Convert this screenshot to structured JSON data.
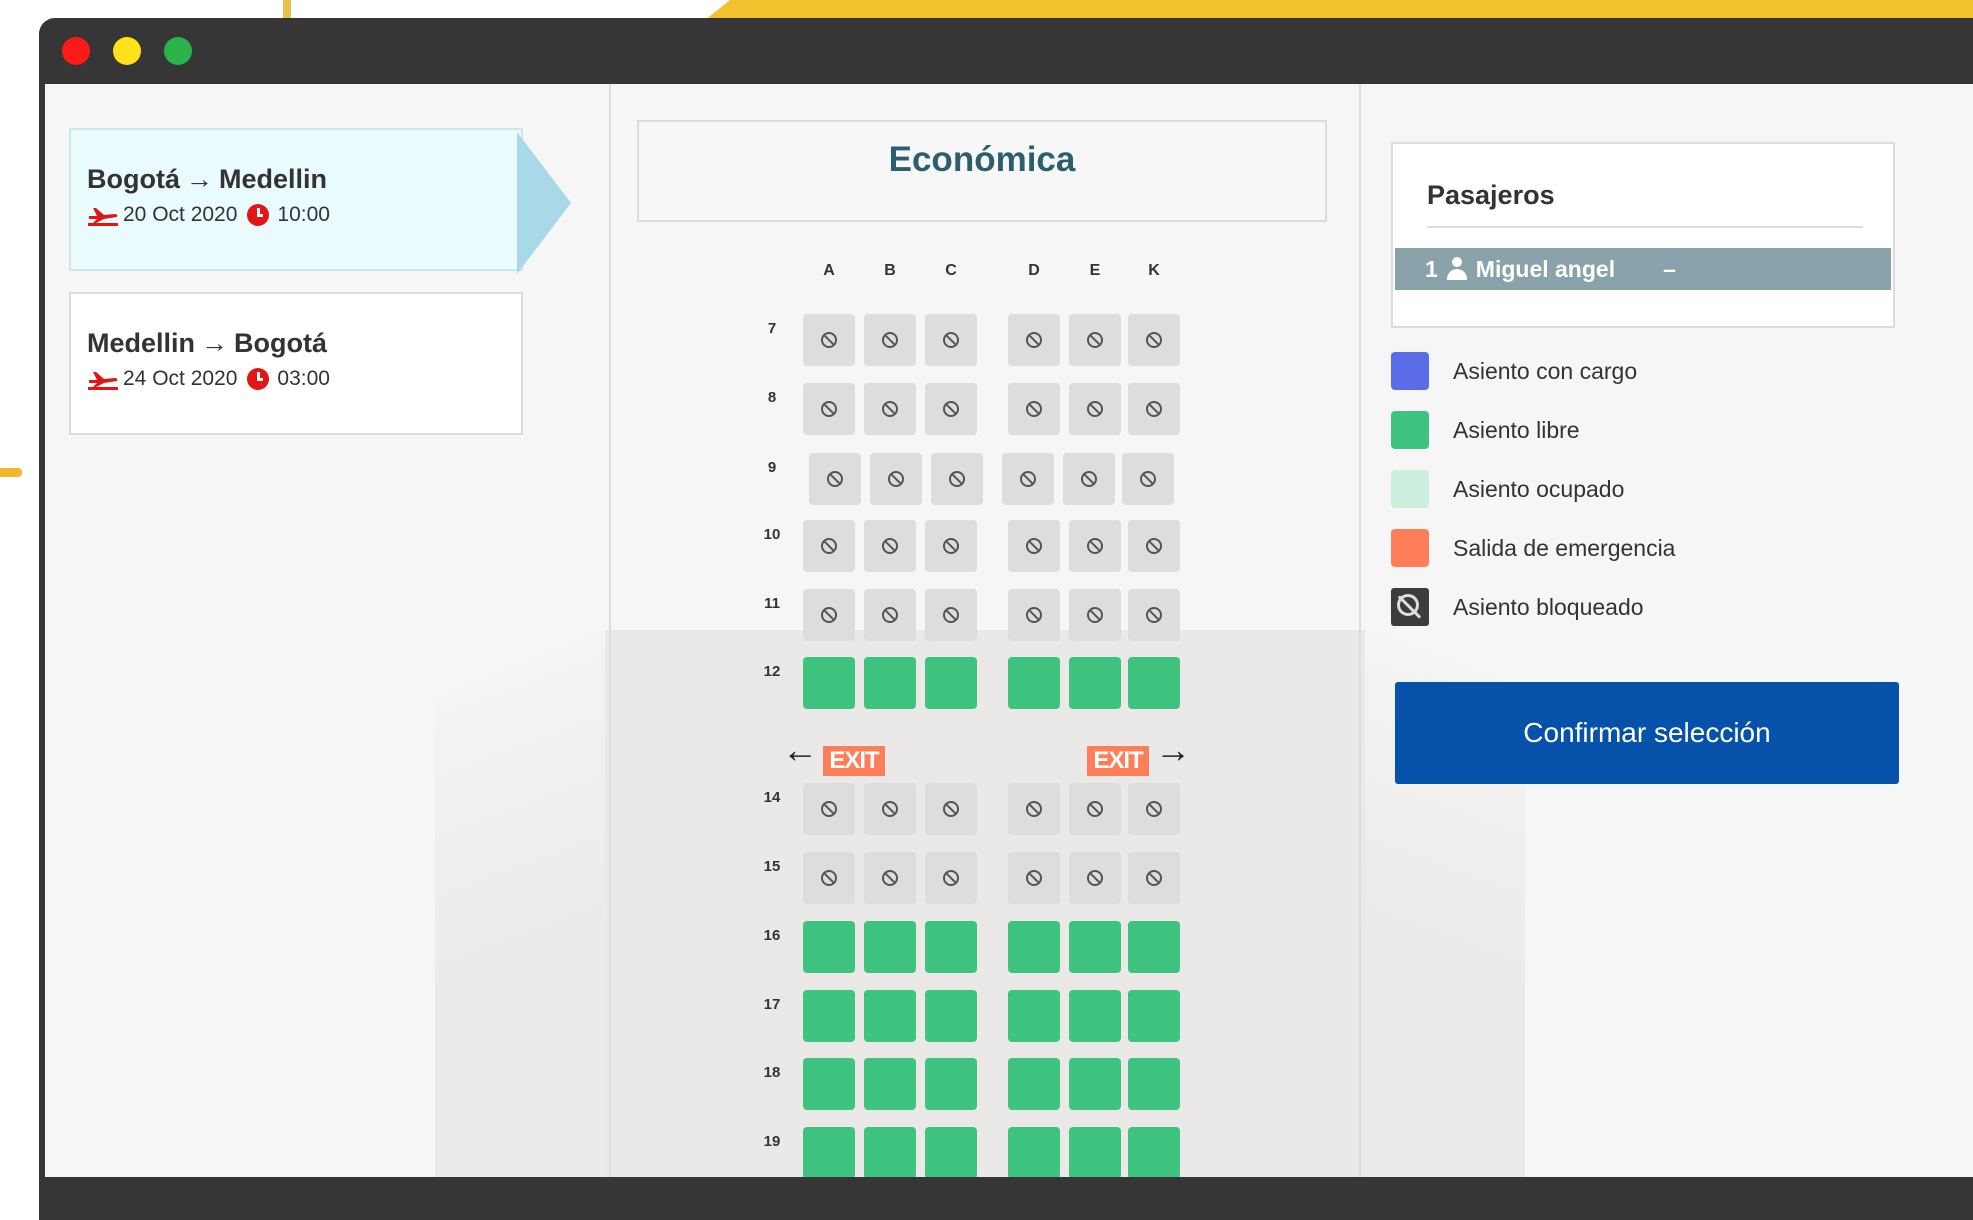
{
  "window": {
    "controls": [
      "close",
      "minimize",
      "maximize"
    ]
  },
  "flights": [
    {
      "from": "Bogotá",
      "to": "Medellin",
      "date": "20 Oct 2020",
      "time": "10:00",
      "active": true
    },
    {
      "from": "Medellin",
      "to": "Bogotá",
      "date": "24 Oct 2020",
      "time": "03:00",
      "active": false
    }
  ],
  "cabin": {
    "title": "Económica",
    "columns": [
      "A",
      "B",
      "C",
      "D",
      "E",
      "K"
    ],
    "rows": [
      {
        "number": "7",
        "status": "blocked"
      },
      {
        "number": "8",
        "status": "blocked"
      },
      {
        "number": "9",
        "status": "blocked"
      },
      {
        "number": "10",
        "status": "blocked"
      },
      {
        "number": "11",
        "status": "blocked"
      },
      {
        "number": "12",
        "status": "free"
      },
      {
        "number": "14",
        "status": "blocked"
      },
      {
        "number": "15",
        "status": "blocked"
      },
      {
        "number": "16",
        "status": "free"
      },
      {
        "number": "17",
        "status": "free"
      },
      {
        "number": "18",
        "status": "free"
      },
      {
        "number": "19",
        "status": "free"
      }
    ],
    "exit_label": "EXIT"
  },
  "passengers": {
    "title": "Pasajeros",
    "list": [
      {
        "index": "1",
        "name": "Miguel angel",
        "seat": "–"
      }
    ]
  },
  "legend": [
    {
      "label": "Asiento con cargo",
      "color": "#5b6ce8"
    },
    {
      "label": "Asiento libre",
      "color": "#3ec47f"
    },
    {
      "label": "Asiento ocupado",
      "color": "#cdeedd"
    },
    {
      "label": "Salida de emergencia",
      "color": "#ff7e5a"
    },
    {
      "label": "Asiento bloqueado",
      "color": "#3c3c3c"
    }
  ],
  "confirm_label": "Confirmar selección"
}
